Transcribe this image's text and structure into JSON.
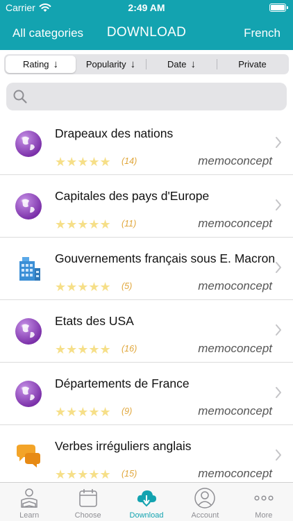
{
  "status": {
    "carrier": "Carrier",
    "time": "2:49 AM"
  },
  "nav": {
    "left": "All categories",
    "title": "DOWNLOAD",
    "right": "French"
  },
  "sort": [
    {
      "label": "Rating",
      "arrow": "↓",
      "active": true
    },
    {
      "label": "Popularity",
      "arrow": "↓",
      "active": false
    },
    {
      "label": "Date",
      "arrow": "↓",
      "active": false
    },
    {
      "label": "Private",
      "arrow": "",
      "active": false
    }
  ],
  "search": {
    "placeholder": "",
    "value": ""
  },
  "items": [
    {
      "title": "Drapeaux des nations",
      "count": "(14)",
      "author": "memoconcept",
      "icon": "globe-icon"
    },
    {
      "title": "Capitales des pays d'Europe",
      "count": "(11)",
      "author": "memoconcept",
      "icon": "globe-icon"
    },
    {
      "title": "Gouvernements français sous E. Macron",
      "count": "(5)",
      "author": "memoconcept",
      "icon": "building-icon"
    },
    {
      "title": "Etats des USA",
      "count": "(16)",
      "author": "memoconcept",
      "icon": "globe-icon"
    },
    {
      "title": "Départements de France",
      "count": "(9)",
      "author": "memoconcept",
      "icon": "globe-icon"
    },
    {
      "title": "Verbes irréguliers anglais",
      "count": "(15)",
      "author": "memoconcept",
      "icon": "speech-bubbles-icon"
    }
  ],
  "stars": "★★★★★",
  "tabs": [
    {
      "label": "Learn",
      "icon": "reader-icon",
      "active": false
    },
    {
      "label": "Choose",
      "icon": "calendar-icon",
      "active": false
    },
    {
      "label": "Download",
      "icon": "cloud-download-icon",
      "active": true
    },
    {
      "label": "Account",
      "icon": "person-icon",
      "active": false
    },
    {
      "label": "More",
      "icon": "more-dots-icon",
      "active": false
    }
  ],
  "colors": {
    "accent": "#13a3b0",
    "star": "#f6df88",
    "count": "#e0a63a"
  }
}
